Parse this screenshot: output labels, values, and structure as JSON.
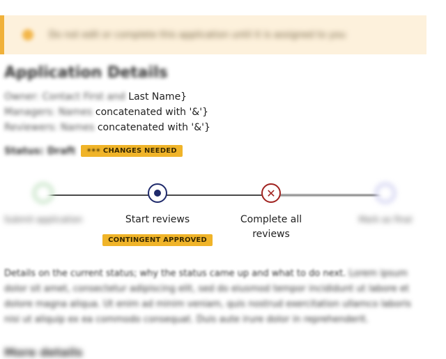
{
  "alert": {
    "icon": "warning-icon",
    "message": "Do not edit or complete this application until it is assigned to you"
  },
  "page": {
    "title": "Application Details"
  },
  "details": [
    {
      "prefix": "Owner: Contact First and",
      "suffix": "Last Name}"
    },
    {
      "prefix": "Managers: Names",
      "suffix": "concatenated with '&'}"
    },
    {
      "prefix": "Reviewers: Names",
      "suffix": "concatenated with '&'}"
    }
  ],
  "status": {
    "label": "Status: Draft",
    "badge": "CHANGES NEEDED",
    "badge_prefix": "•••"
  },
  "stepper": {
    "steps": [
      {
        "label": "Submit application",
        "state": "done"
      },
      {
        "label": "Start reviews",
        "state": "current",
        "badge": "CONTINGENT APPROVED"
      },
      {
        "label": "Complete all reviews",
        "state": "error"
      },
      {
        "label": "Mark as final",
        "state": "future"
      }
    ],
    "colors": {
      "current": "#1f2a6b",
      "error": "#a0221f",
      "badge": "#f0b429",
      "line": "#4a4a4a"
    }
  },
  "paragraph": {
    "lead": "Details on the current status; why the status came up and what to do next.",
    "mid": "Lorem ipsum dolor sit amet, consectetur adipiscing elit, sed do eiusmod tempor incididunt ut labore et dolore magna aliqua. Ut enim ad minim veniam, quis nostrud exercitation ullamco laboris nisi ut aliquip ex ea commodo consequat. Duis aute irure dolor in reprehenderit."
  },
  "section": {
    "heading": "More details"
  }
}
